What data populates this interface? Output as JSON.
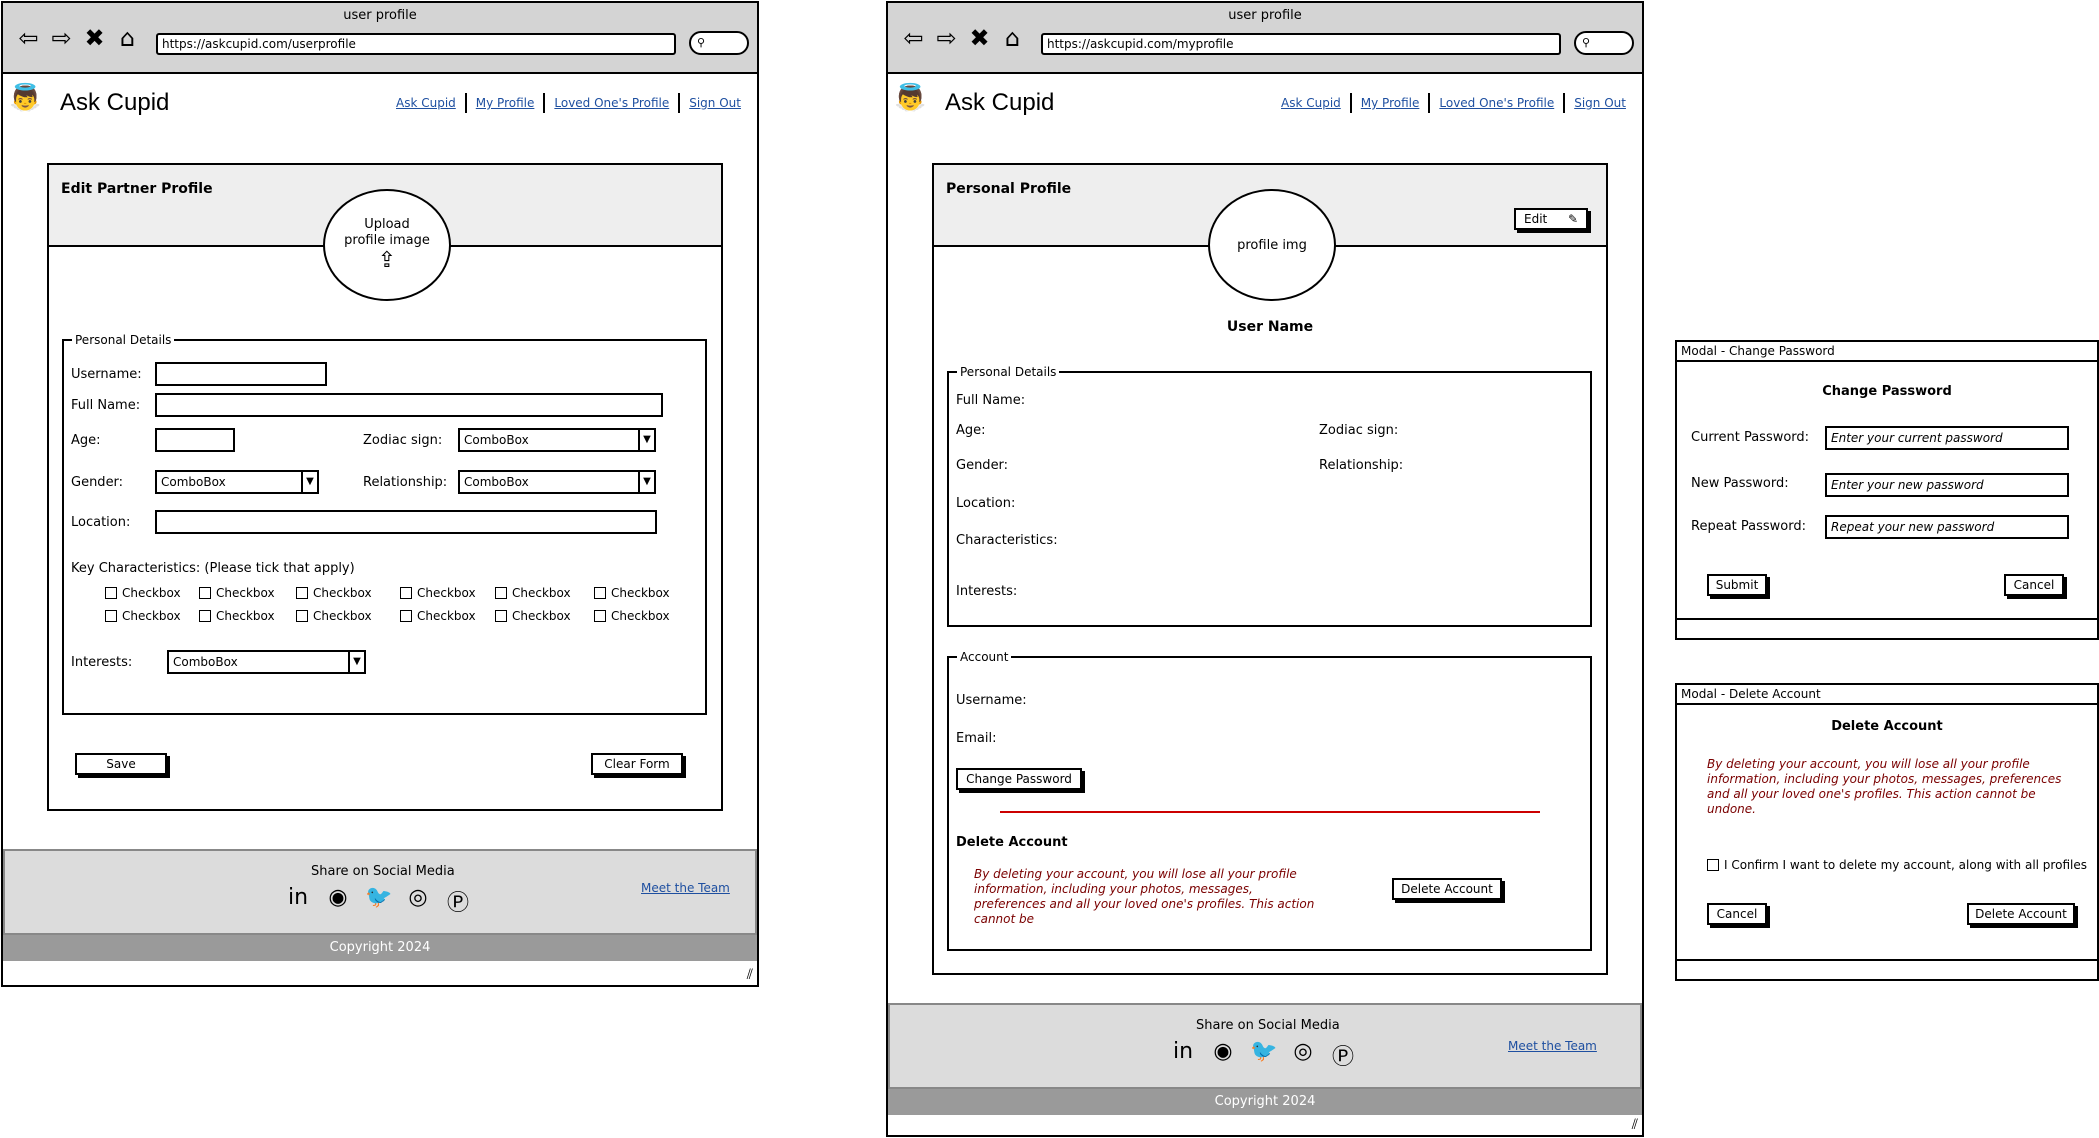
{
  "left": {
    "window_title": "user profile",
    "url": "https://askcupid.com/userprofile",
    "app_name": "Ask Cupid",
    "nav": [
      "Ask Cupid",
      "My Profile",
      "Loved One's Profile",
      "Sign Out"
    ],
    "panel_title": "Edit Partner Profile",
    "upload_text": "Upload profile image",
    "section_personal": "Personal Details",
    "labels": {
      "username": "Username:",
      "full_name": "Full Name:",
      "age": "Age:",
      "zodiac": "Zodiac sign:",
      "gender": "Gender:",
      "relationship": "Relationship:",
      "location": "Location:",
      "key_chars": "Key Characteristics: (Please tick that apply)",
      "interests": "Interests:"
    },
    "combo_value": "ComboBox",
    "checkbox_label": "Checkbox",
    "save": "Save",
    "clear": "Clear Form",
    "share": "Share on Social Media",
    "meet_team": "Meet the Team",
    "copyright": "Copyright 2024"
  },
  "middle": {
    "window_title": "user profile",
    "url": "https://askcupid.com/myprofile",
    "app_name": "Ask Cupid",
    "nav": [
      "Ask Cupid",
      "My Profile",
      "Loved One's Profile",
      "Sign Out"
    ],
    "panel_title": "Personal Profile",
    "edit": "Edit",
    "profile_img": "profile img",
    "user_name": "User Name",
    "section_personal": "Personal Details",
    "labels": {
      "full_name": "Full Name:",
      "age": "Age:",
      "zodiac": "Zodiac sign:",
      "gender": "Gender:",
      "relationship": "Relationship:",
      "location": "Location:",
      "characteristics": "Characteristics:",
      "interests": "Interests:"
    },
    "section_account": "Account",
    "username": "Username:",
    "email": "Email:",
    "change_password": "Change Password",
    "delete_heading": "Delete Account",
    "delete_warning": "By deleting your account, you will lose all your profile information, including your photos, messages, preferences and all your loved one's profiles. This action cannot be",
    "delete_button": "Delete Account",
    "share": "Share on Social Media",
    "meet_team": "Meet the Team",
    "copyright": "Copyright 2024"
  },
  "modal_password": {
    "header": "Modal - Change Password",
    "title": "Change Password",
    "current_label": "Current Password:",
    "current_ph": "Enter your current password",
    "new_label": "New Password:",
    "new_ph": "Enter your new password",
    "repeat_label": "Repeat Password:",
    "repeat_ph": "Repeat your new password",
    "submit": "Submit",
    "cancel": "Cancel"
  },
  "modal_delete": {
    "header": "Modal - Delete Account",
    "title": "Delete Account",
    "warning": "By deleting your account, you will lose all your profile information, including your photos, messages, preferences and all your loved one's profiles. This action cannot be undone.",
    "confirm": "I Confirm I want to delete my account, along with all profiles",
    "cancel": "Cancel",
    "delete": "Delete Account"
  },
  "icons": {
    "back": "back-arrow-icon",
    "forward": "forward-arrow-icon",
    "stop": "close-icon",
    "home": "home-icon",
    "search": "search-icon",
    "upload": "upload-icon",
    "pencil": "pencil-icon",
    "social": [
      "linkedin-icon",
      "github-icon",
      "twitter-icon",
      "instagram-icon",
      "pinterest-icon"
    ],
    "logo": "cupid-logo"
  },
  "colors": {
    "link": "#1e4fa0",
    "warning": "#7a0000",
    "header_bg": "#d4d4d4",
    "footer_bg": "#dcdcdc",
    "copyright_bg": "#9a9a9a",
    "divider": "#cc0000"
  }
}
